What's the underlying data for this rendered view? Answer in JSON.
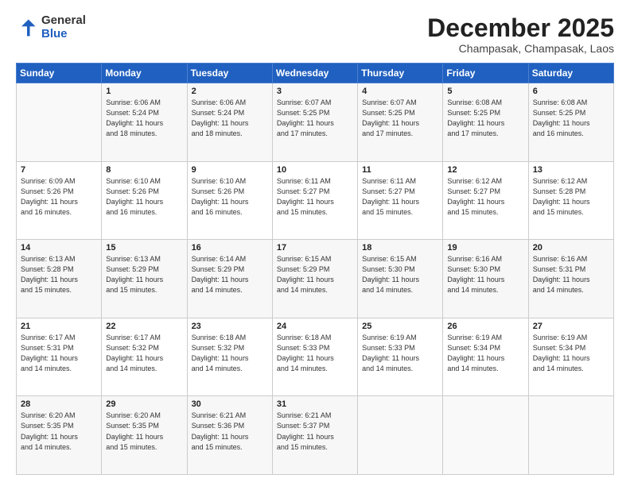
{
  "header": {
    "logo_general": "General",
    "logo_blue": "Blue",
    "month_title": "December 2025",
    "subtitle": "Champasak, Champasak, Laos"
  },
  "days_of_week": [
    "Sunday",
    "Monday",
    "Tuesday",
    "Wednesday",
    "Thursday",
    "Friday",
    "Saturday"
  ],
  "weeks": [
    [
      {
        "day": "",
        "info": ""
      },
      {
        "day": "1",
        "info": "Sunrise: 6:06 AM\nSunset: 5:24 PM\nDaylight: 11 hours\nand 18 minutes."
      },
      {
        "day": "2",
        "info": "Sunrise: 6:06 AM\nSunset: 5:24 PM\nDaylight: 11 hours\nand 18 minutes."
      },
      {
        "day": "3",
        "info": "Sunrise: 6:07 AM\nSunset: 5:25 PM\nDaylight: 11 hours\nand 17 minutes."
      },
      {
        "day": "4",
        "info": "Sunrise: 6:07 AM\nSunset: 5:25 PM\nDaylight: 11 hours\nand 17 minutes."
      },
      {
        "day": "5",
        "info": "Sunrise: 6:08 AM\nSunset: 5:25 PM\nDaylight: 11 hours\nand 17 minutes."
      },
      {
        "day": "6",
        "info": "Sunrise: 6:08 AM\nSunset: 5:25 PM\nDaylight: 11 hours\nand 16 minutes."
      }
    ],
    [
      {
        "day": "7",
        "info": "Sunrise: 6:09 AM\nSunset: 5:26 PM\nDaylight: 11 hours\nand 16 minutes."
      },
      {
        "day": "8",
        "info": "Sunrise: 6:10 AM\nSunset: 5:26 PM\nDaylight: 11 hours\nand 16 minutes."
      },
      {
        "day": "9",
        "info": "Sunrise: 6:10 AM\nSunset: 5:26 PM\nDaylight: 11 hours\nand 16 minutes."
      },
      {
        "day": "10",
        "info": "Sunrise: 6:11 AM\nSunset: 5:27 PM\nDaylight: 11 hours\nand 15 minutes."
      },
      {
        "day": "11",
        "info": "Sunrise: 6:11 AM\nSunset: 5:27 PM\nDaylight: 11 hours\nand 15 minutes."
      },
      {
        "day": "12",
        "info": "Sunrise: 6:12 AM\nSunset: 5:27 PM\nDaylight: 11 hours\nand 15 minutes."
      },
      {
        "day": "13",
        "info": "Sunrise: 6:12 AM\nSunset: 5:28 PM\nDaylight: 11 hours\nand 15 minutes."
      }
    ],
    [
      {
        "day": "14",
        "info": "Sunrise: 6:13 AM\nSunset: 5:28 PM\nDaylight: 11 hours\nand 15 minutes."
      },
      {
        "day": "15",
        "info": "Sunrise: 6:13 AM\nSunset: 5:29 PM\nDaylight: 11 hours\nand 15 minutes."
      },
      {
        "day": "16",
        "info": "Sunrise: 6:14 AM\nSunset: 5:29 PM\nDaylight: 11 hours\nand 14 minutes."
      },
      {
        "day": "17",
        "info": "Sunrise: 6:15 AM\nSunset: 5:29 PM\nDaylight: 11 hours\nand 14 minutes."
      },
      {
        "day": "18",
        "info": "Sunrise: 6:15 AM\nSunset: 5:30 PM\nDaylight: 11 hours\nand 14 minutes."
      },
      {
        "day": "19",
        "info": "Sunrise: 6:16 AM\nSunset: 5:30 PM\nDaylight: 11 hours\nand 14 minutes."
      },
      {
        "day": "20",
        "info": "Sunrise: 6:16 AM\nSunset: 5:31 PM\nDaylight: 11 hours\nand 14 minutes."
      }
    ],
    [
      {
        "day": "21",
        "info": "Sunrise: 6:17 AM\nSunset: 5:31 PM\nDaylight: 11 hours\nand 14 minutes."
      },
      {
        "day": "22",
        "info": "Sunrise: 6:17 AM\nSunset: 5:32 PM\nDaylight: 11 hours\nand 14 minutes."
      },
      {
        "day": "23",
        "info": "Sunrise: 6:18 AM\nSunset: 5:32 PM\nDaylight: 11 hours\nand 14 minutes."
      },
      {
        "day": "24",
        "info": "Sunrise: 6:18 AM\nSunset: 5:33 PM\nDaylight: 11 hours\nand 14 minutes."
      },
      {
        "day": "25",
        "info": "Sunrise: 6:19 AM\nSunset: 5:33 PM\nDaylight: 11 hours\nand 14 minutes."
      },
      {
        "day": "26",
        "info": "Sunrise: 6:19 AM\nSunset: 5:34 PM\nDaylight: 11 hours\nand 14 minutes."
      },
      {
        "day": "27",
        "info": "Sunrise: 6:19 AM\nSunset: 5:34 PM\nDaylight: 11 hours\nand 14 minutes."
      }
    ],
    [
      {
        "day": "28",
        "info": "Sunrise: 6:20 AM\nSunset: 5:35 PM\nDaylight: 11 hours\nand 14 minutes."
      },
      {
        "day": "29",
        "info": "Sunrise: 6:20 AM\nSunset: 5:35 PM\nDaylight: 11 hours\nand 15 minutes."
      },
      {
        "day": "30",
        "info": "Sunrise: 6:21 AM\nSunset: 5:36 PM\nDaylight: 11 hours\nand 15 minutes."
      },
      {
        "day": "31",
        "info": "Sunrise: 6:21 AM\nSunset: 5:37 PM\nDaylight: 11 hours\nand 15 minutes."
      },
      {
        "day": "",
        "info": ""
      },
      {
        "day": "",
        "info": ""
      },
      {
        "day": "",
        "info": ""
      }
    ]
  ]
}
